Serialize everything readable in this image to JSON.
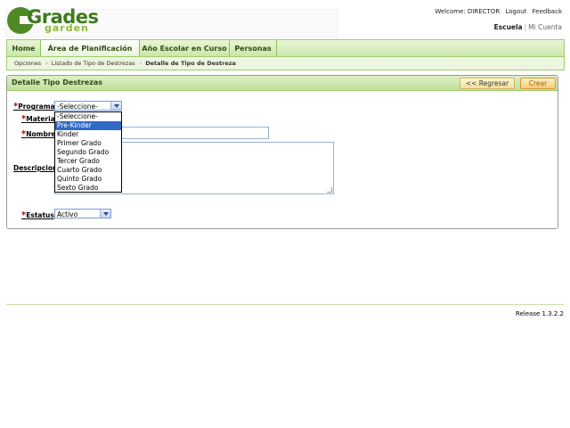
{
  "brand": {
    "main": "Grades",
    "sub": "garden"
  },
  "user_links": {
    "welcome": "Welcome: DIRECTOR",
    "logout": "Logout",
    "feedback": "Feedback"
  },
  "school_links": {
    "active": "Escuela",
    "separator": "|",
    "other": "Mi Cuenta"
  },
  "nav": {
    "tabs": [
      {
        "label": "Home"
      },
      {
        "label": "Área de Planificación"
      },
      {
        "label": "Año Escolar en Curso"
      },
      {
        "label": "Personas"
      }
    ]
  },
  "breadcrumb": {
    "items": [
      "Opciones",
      "Listado de Tipo de Destrezas",
      "Detalle de Tipo de Destreza"
    ],
    "arrow": "›"
  },
  "panel": {
    "title": "Detalle Tipo Destrezas",
    "back_label": "<< Regresar",
    "new_label": "Crear"
  },
  "form": {
    "programa_label": "Programa",
    "materia_label": "Materia",
    "nombre_label": "Nombre",
    "descripcion_label": "Descripcion",
    "estatus_label": "Estatus",
    "required_marker": "*",
    "programa_value": "-Seleccione-",
    "estatus_value": "Activo",
    "programa_options": [
      "-Seleccione-",
      "Pre-Kinder",
      "Kinder",
      "Primer Grado",
      "Segundo Grado",
      "Tercer Grado",
      "Cuarto Grado",
      "Quinto Grado",
      "Sexto Grado"
    ],
    "highlighted_option": "Pre-Kinder"
  },
  "footer": {
    "release": "Release 1.3.2.2"
  },
  "colors": {
    "accent_green": "#3f7a1d",
    "nav_bg": "#c9e6a7",
    "selection_blue": "#316ac5",
    "required_red": "#cc0000"
  }
}
